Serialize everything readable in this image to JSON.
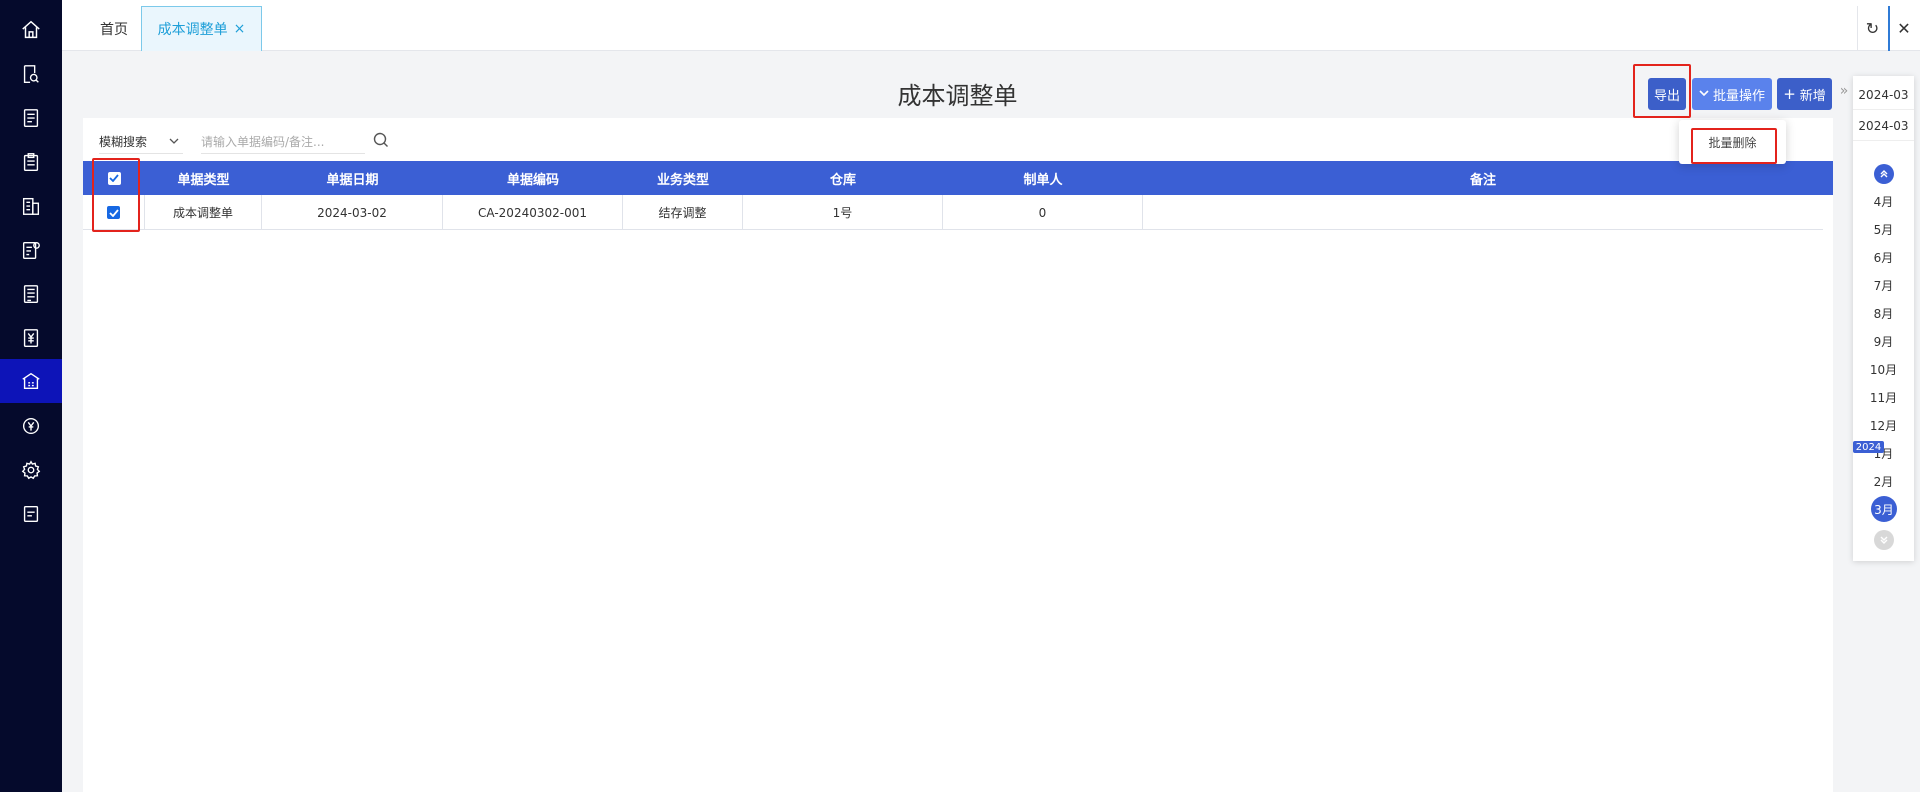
{
  "tabs": {
    "home_label": "首页",
    "active_label": "成本调整单",
    "close_glyph": "×",
    "refresh_glyph": "↻",
    "close_all_glyph": "✕"
  },
  "page": {
    "title": "成本调整单"
  },
  "toolbar": {
    "export_label": "导出",
    "batch_label": "批量操作",
    "add_label": "新增",
    "collapse_glyph": "»",
    "dropdown": {
      "delete_label": "批量删除"
    }
  },
  "search": {
    "mode_label": "模糊搜索",
    "placeholder": "请输入单据编码/备注..."
  },
  "table": {
    "columns": [
      "单据类型",
      "单据日期",
      "单据编码",
      "业务类型",
      "仓库",
      "制单人",
      "备注"
    ],
    "rows": [
      {
        "type": "成本调整单",
        "date": "2024-03-02",
        "code": "CA-20240302-001",
        "biz": "结存调整",
        "warehouse": "1号",
        "creator": "0",
        "remark": ""
      }
    ]
  },
  "rail": {
    "start": "2024-03",
    "end": "2024-03",
    "months": [
      "4月",
      "5月",
      "6月",
      "7月",
      "8月",
      "9月",
      "10月",
      "11月",
      "12月",
      "1月",
      "2月"
    ],
    "active_month": "3月",
    "year_badge": "2024"
  },
  "colors": {
    "sidebar_bg": "#050a2c",
    "sidebar_active": "#0d14b8",
    "header_blue": "#3b5fd4",
    "highlight_red": "#e3231c"
  },
  "icons": [
    "home-icon",
    "search-doc-icon",
    "list-doc-icon",
    "clipboard-icon",
    "building-icon",
    "doc-setting-icon",
    "document-icon",
    "yen-doc-icon",
    "warehouse-icon",
    "yen-circle-icon",
    "gear-icon",
    "report-icon"
  ]
}
